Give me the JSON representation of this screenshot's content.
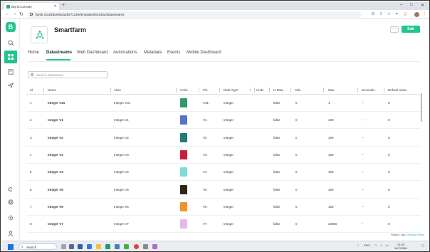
{
  "browser": {
    "tab_title": "Blynk.Console",
    "url": "blynk.cloud/dashboard/271229/templates/501262/datastreams"
  },
  "header": {
    "title": "Smartfarm",
    "more_label": "···",
    "edit_label": "Edit"
  },
  "tabs": [
    "Home",
    "Datastreams",
    "Web Dashboard",
    "Automations",
    "Metadata",
    "Events",
    "Mobile Dashboard"
  ],
  "search": {
    "placeholder": "Search datastream"
  },
  "table": {
    "columns": [
      "Id",
      "Name",
      "Alias",
      "Color",
      "Pin",
      "Data Type",
      "Units",
      "Is Raw",
      "Min",
      "Max",
      "Decimals",
      "Default Value"
    ],
    "rows": [
      {
        "id": "1",
        "name": "Integer V31",
        "alias": "Integer V31",
        "color": "#2e9b6a",
        "pin": "V31",
        "type": "Integer",
        "raw": "false",
        "min": "0",
        "max": "1",
        "decimals": "–",
        "default": "0"
      },
      {
        "id": "2",
        "name": "Integer V1",
        "alias": "Integer V1",
        "color": "#5b72c9",
        "pin": "V1",
        "type": "Integer",
        "raw": "false",
        "min": "0",
        "max": "100",
        "decimals": "–",
        "default": "0"
      },
      {
        "id": "3",
        "name": "Integer V2",
        "alias": "Integer V2",
        "color": "#1f7d78",
        "pin": "V2",
        "type": "Integer",
        "raw": "false",
        "min": "0",
        "max": "100",
        "decimals": "–",
        "default": "0"
      },
      {
        "id": "4",
        "name": "Integer V3",
        "alias": "Integer V3",
        "color": "#c4223a",
        "pin": "V3",
        "type": "Integer",
        "raw": "false",
        "min": "0",
        "max": "100",
        "decimals": "–",
        "default": "0"
      },
      {
        "id": "5",
        "name": "Integer V4",
        "alias": "Integer V4",
        "color": "#7fdada",
        "pin": "V4",
        "type": "Integer",
        "raw": "false",
        "min": "0",
        "max": "100",
        "decimals": "–",
        "default": "0"
      },
      {
        "id": "6",
        "name": "Integer V5",
        "alias": "Integer V5",
        "color": "#2e2a12",
        "pin": "V5",
        "type": "Integer",
        "raw": "false",
        "min": "0",
        "max": "100",
        "decimals": "–",
        "default": "0"
      },
      {
        "id": "7",
        "name": "Integer V6",
        "alias": "Integer V6",
        "color": "#f0922a",
        "pin": "V6",
        "type": "Integer",
        "raw": "false",
        "min": "0",
        "max": "100",
        "decimals": "–",
        "default": "0"
      },
      {
        "id": "8",
        "name": "Integer V7",
        "alias": "Integer V7",
        "color": "#e4b8e8",
        "pin": "V7",
        "type": "Integer",
        "raw": "false",
        "min": "0",
        "max": "34000",
        "decimals": "–",
        "default": "0"
      }
    ]
  },
  "footer": {
    "text": "Region: sgp1",
    "link": "Privacy Policy"
  },
  "taskbar": {
    "search_label": "Search",
    "lang": "ENG",
    "time": "13:28",
    "date": "16/7/2566"
  },
  "colors": {
    "accent": "#23c48e"
  }
}
